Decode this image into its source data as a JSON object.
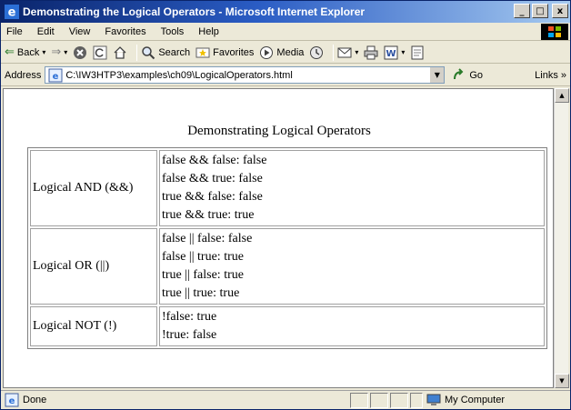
{
  "window": {
    "title": "Demonstrating the Logical Operators - Microsoft Internet Explorer",
    "buttons": {
      "minimize": "_",
      "maximize": "□",
      "close": "x"
    }
  },
  "menubar": {
    "items": [
      "File",
      "Edit",
      "View",
      "Favorites",
      "Tools",
      "Help"
    ]
  },
  "toolbar": {
    "back_label": "Back",
    "search_label": "Search",
    "favorites_label": "Favorites",
    "media_label": "Media"
  },
  "addressbar": {
    "label": "Address",
    "value": "C:\\IW3HTP3\\examples\\ch09\\LogicalOperators.html",
    "go_label": "Go",
    "links_label": "Links »"
  },
  "page": {
    "caption": "Demonstrating Logical Operators",
    "rows": [
      {
        "label": "Logical AND (&&)",
        "lines": [
          "false && false: false",
          "false && true: false",
          "true && false: false",
          "true && true: true"
        ]
      },
      {
        "label": "Logical OR (||)",
        "lines": [
          "false || false: false",
          "false || true: true",
          "true || false: true",
          "true || true: true"
        ]
      },
      {
        "label": "Logical NOT (!)",
        "lines": [
          "!false: true",
          "!true: false"
        ]
      }
    ]
  },
  "statusbar": {
    "status": "Done",
    "zone": "My Computer"
  }
}
